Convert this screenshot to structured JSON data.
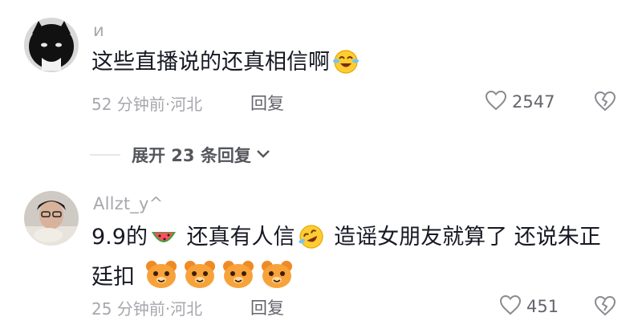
{
  "comments": [
    {
      "username": "и",
      "text_parts": [
        "这些直播说的还真相信啊"
      ],
      "time": "52 分钟前",
      "location": "·河北",
      "reply_label": "回复",
      "likes": "2547"
    },
    {
      "username": "Allzt_y^",
      "text_line1_a": "9.9的",
      "text_line1_b": "还真有人信",
      "text_line1_c": "造谣女朋友就算了 还说朱正",
      "text_line2": "廷扣",
      "time": "25 分钟前",
      "location": "·河北",
      "reply_label": "回复",
      "likes": "451"
    }
  ],
  "expand_replies": "展开 23 条回复",
  "colors": {
    "text": "#161823",
    "muted": "#a7a7ad",
    "secondary": "#64656c"
  },
  "icons": [
    "heart-icon",
    "broken-heart-icon",
    "chevron-down-icon",
    "laugh-cry-emoji-icon",
    "watermelon-emoji-icon",
    "rofl-emoji-icon",
    "bear-emoji-icon"
  ]
}
